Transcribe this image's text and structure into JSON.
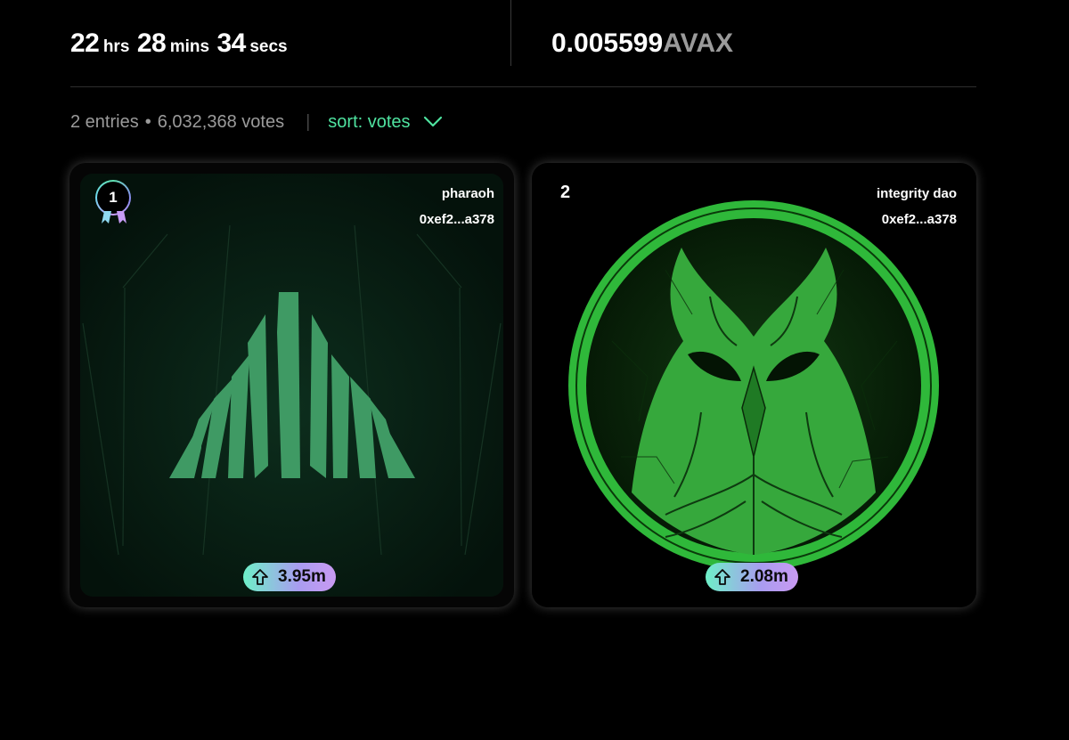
{
  "countdown": {
    "hours": "22",
    "hours_unit": "hrs",
    "minutes": "28",
    "minutes_unit": "mins",
    "seconds": "34",
    "seconds_unit": "secs"
  },
  "prize": {
    "amount": "0.005599",
    "currency": "AVAX"
  },
  "summary": {
    "entries": "2 entries",
    "separator_dot": "•",
    "votes": "6,032,368 votes",
    "divider": "|",
    "sort_label": "sort: votes",
    "sort_icon": "chevron-down-icon"
  },
  "entries": [
    {
      "rank": "1",
      "name": "pharaoh",
      "address": "0xef2...a378",
      "votes": "3.95m",
      "badge": "medal-icon",
      "artwork": "pyramid-logo"
    },
    {
      "rank": "2",
      "name": "integrity dao",
      "address": "0xef2...a378",
      "votes": "2.08m",
      "artwork": "green-owl-emblem"
    }
  ],
  "colors": {
    "accent": "#4fe3a0",
    "muted": "#9b9b9b",
    "pill_gradient_start": "#6ef0c8",
    "pill_gradient_end": "#c99af2",
    "art_green": "#3f9a64",
    "owl_green": "#2fb83a"
  },
  "icons": {
    "upvote": "arrow-up-icon"
  }
}
